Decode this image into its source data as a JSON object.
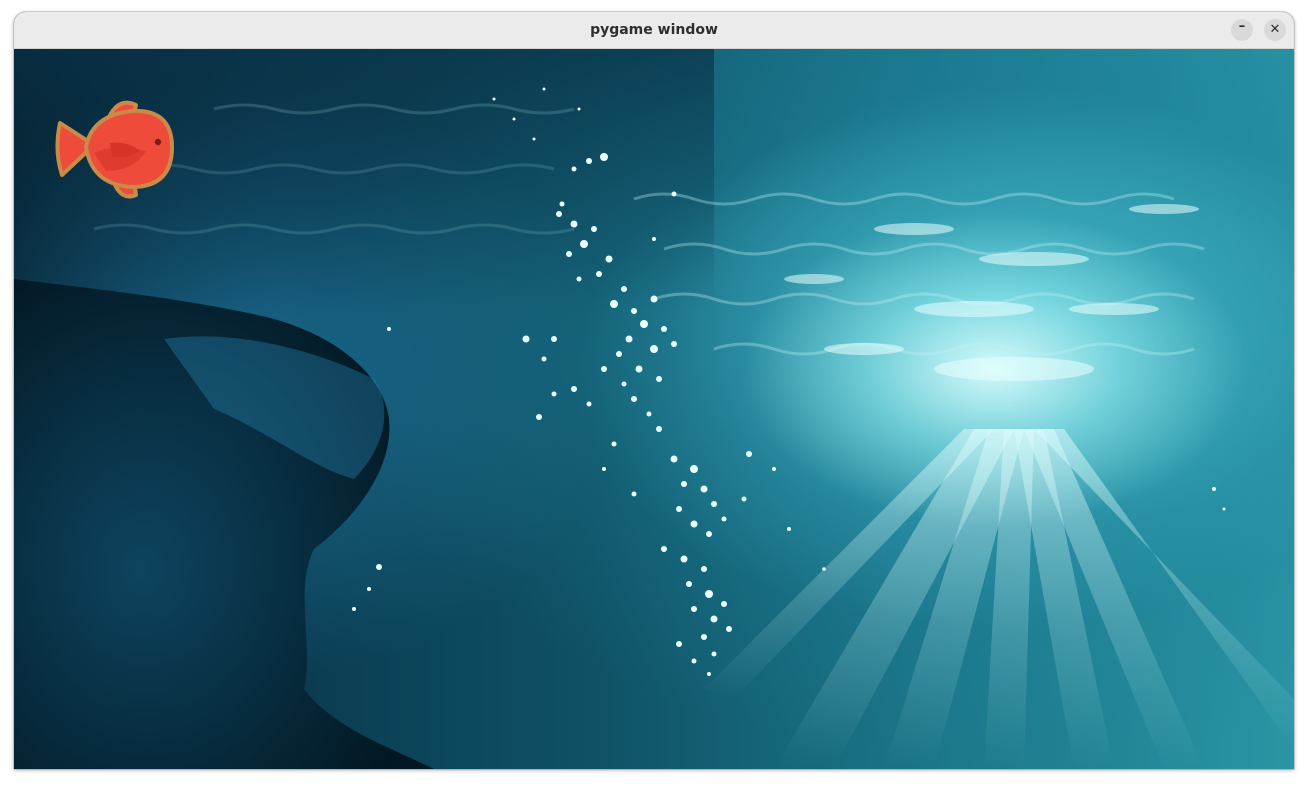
{
  "window": {
    "title": "pygame window",
    "minimize_label": "–",
    "close_label": "✕"
  },
  "scene": {
    "background": "underwater-ocean-with-light-rays-and-bubbles",
    "player": {
      "icon": "red-fish-icon",
      "body_color": "#ef4b3a",
      "outline_color": "#c98a4a"
    }
  }
}
